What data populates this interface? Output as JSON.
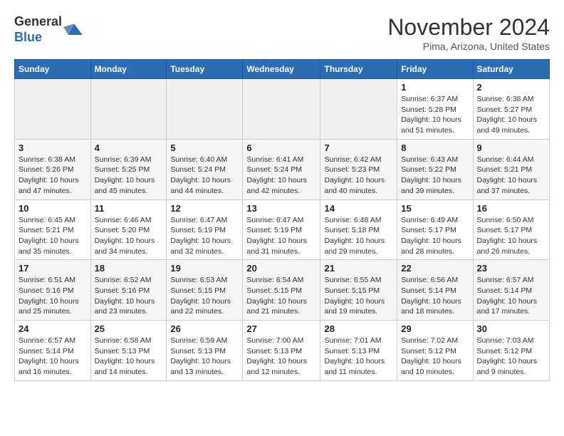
{
  "header": {
    "logo_general": "General",
    "logo_blue": "Blue",
    "month_title": "November 2024",
    "location": "Pima, Arizona, United States"
  },
  "days_of_week": [
    "Sunday",
    "Monday",
    "Tuesday",
    "Wednesday",
    "Thursday",
    "Friday",
    "Saturday"
  ],
  "weeks": [
    [
      {
        "day": "",
        "info": ""
      },
      {
        "day": "",
        "info": ""
      },
      {
        "day": "",
        "info": ""
      },
      {
        "day": "",
        "info": ""
      },
      {
        "day": "",
        "info": ""
      },
      {
        "day": "1",
        "info": "Sunrise: 6:37 AM\nSunset: 5:28 PM\nDaylight: 10 hours and 51 minutes."
      },
      {
        "day": "2",
        "info": "Sunrise: 6:38 AM\nSunset: 5:27 PM\nDaylight: 10 hours and 49 minutes."
      }
    ],
    [
      {
        "day": "3",
        "info": "Sunrise: 6:38 AM\nSunset: 5:26 PM\nDaylight: 10 hours and 47 minutes."
      },
      {
        "day": "4",
        "info": "Sunrise: 6:39 AM\nSunset: 5:25 PM\nDaylight: 10 hours and 45 minutes."
      },
      {
        "day": "5",
        "info": "Sunrise: 6:40 AM\nSunset: 5:24 PM\nDaylight: 10 hours and 44 minutes."
      },
      {
        "day": "6",
        "info": "Sunrise: 6:41 AM\nSunset: 5:24 PM\nDaylight: 10 hours and 42 minutes."
      },
      {
        "day": "7",
        "info": "Sunrise: 6:42 AM\nSunset: 5:23 PM\nDaylight: 10 hours and 40 minutes."
      },
      {
        "day": "8",
        "info": "Sunrise: 6:43 AM\nSunset: 5:22 PM\nDaylight: 10 hours and 39 minutes."
      },
      {
        "day": "9",
        "info": "Sunrise: 6:44 AM\nSunset: 5:21 PM\nDaylight: 10 hours and 37 minutes."
      }
    ],
    [
      {
        "day": "10",
        "info": "Sunrise: 6:45 AM\nSunset: 5:21 PM\nDaylight: 10 hours and 35 minutes."
      },
      {
        "day": "11",
        "info": "Sunrise: 6:46 AM\nSunset: 5:20 PM\nDaylight: 10 hours and 34 minutes."
      },
      {
        "day": "12",
        "info": "Sunrise: 6:47 AM\nSunset: 5:19 PM\nDaylight: 10 hours and 32 minutes."
      },
      {
        "day": "13",
        "info": "Sunrise: 6:47 AM\nSunset: 5:19 PM\nDaylight: 10 hours and 31 minutes."
      },
      {
        "day": "14",
        "info": "Sunrise: 6:48 AM\nSunset: 5:18 PM\nDaylight: 10 hours and 29 minutes."
      },
      {
        "day": "15",
        "info": "Sunrise: 6:49 AM\nSunset: 5:17 PM\nDaylight: 10 hours and 28 minutes."
      },
      {
        "day": "16",
        "info": "Sunrise: 6:50 AM\nSunset: 5:17 PM\nDaylight: 10 hours and 26 minutes."
      }
    ],
    [
      {
        "day": "17",
        "info": "Sunrise: 6:51 AM\nSunset: 5:16 PM\nDaylight: 10 hours and 25 minutes."
      },
      {
        "day": "18",
        "info": "Sunrise: 6:52 AM\nSunset: 5:16 PM\nDaylight: 10 hours and 23 minutes."
      },
      {
        "day": "19",
        "info": "Sunrise: 6:53 AM\nSunset: 5:15 PM\nDaylight: 10 hours and 22 minutes."
      },
      {
        "day": "20",
        "info": "Sunrise: 6:54 AM\nSunset: 5:15 PM\nDaylight: 10 hours and 21 minutes."
      },
      {
        "day": "21",
        "info": "Sunrise: 6:55 AM\nSunset: 5:15 PM\nDaylight: 10 hours and 19 minutes."
      },
      {
        "day": "22",
        "info": "Sunrise: 6:56 AM\nSunset: 5:14 PM\nDaylight: 10 hours and 18 minutes."
      },
      {
        "day": "23",
        "info": "Sunrise: 6:57 AM\nSunset: 5:14 PM\nDaylight: 10 hours and 17 minutes."
      }
    ],
    [
      {
        "day": "24",
        "info": "Sunrise: 6:57 AM\nSunset: 5:14 PM\nDaylight: 10 hours and 16 minutes."
      },
      {
        "day": "25",
        "info": "Sunrise: 6:58 AM\nSunset: 5:13 PM\nDaylight: 10 hours and 14 minutes."
      },
      {
        "day": "26",
        "info": "Sunrise: 6:59 AM\nSunset: 5:13 PM\nDaylight: 10 hours and 13 minutes."
      },
      {
        "day": "27",
        "info": "Sunrise: 7:00 AM\nSunset: 5:13 PM\nDaylight: 10 hours and 12 minutes."
      },
      {
        "day": "28",
        "info": "Sunrise: 7:01 AM\nSunset: 5:13 PM\nDaylight: 10 hours and 11 minutes."
      },
      {
        "day": "29",
        "info": "Sunrise: 7:02 AM\nSunset: 5:12 PM\nDaylight: 10 hours and 10 minutes."
      },
      {
        "day": "30",
        "info": "Sunrise: 7:03 AM\nSunset: 5:12 PM\nDaylight: 10 hours and 9 minutes."
      }
    ]
  ]
}
